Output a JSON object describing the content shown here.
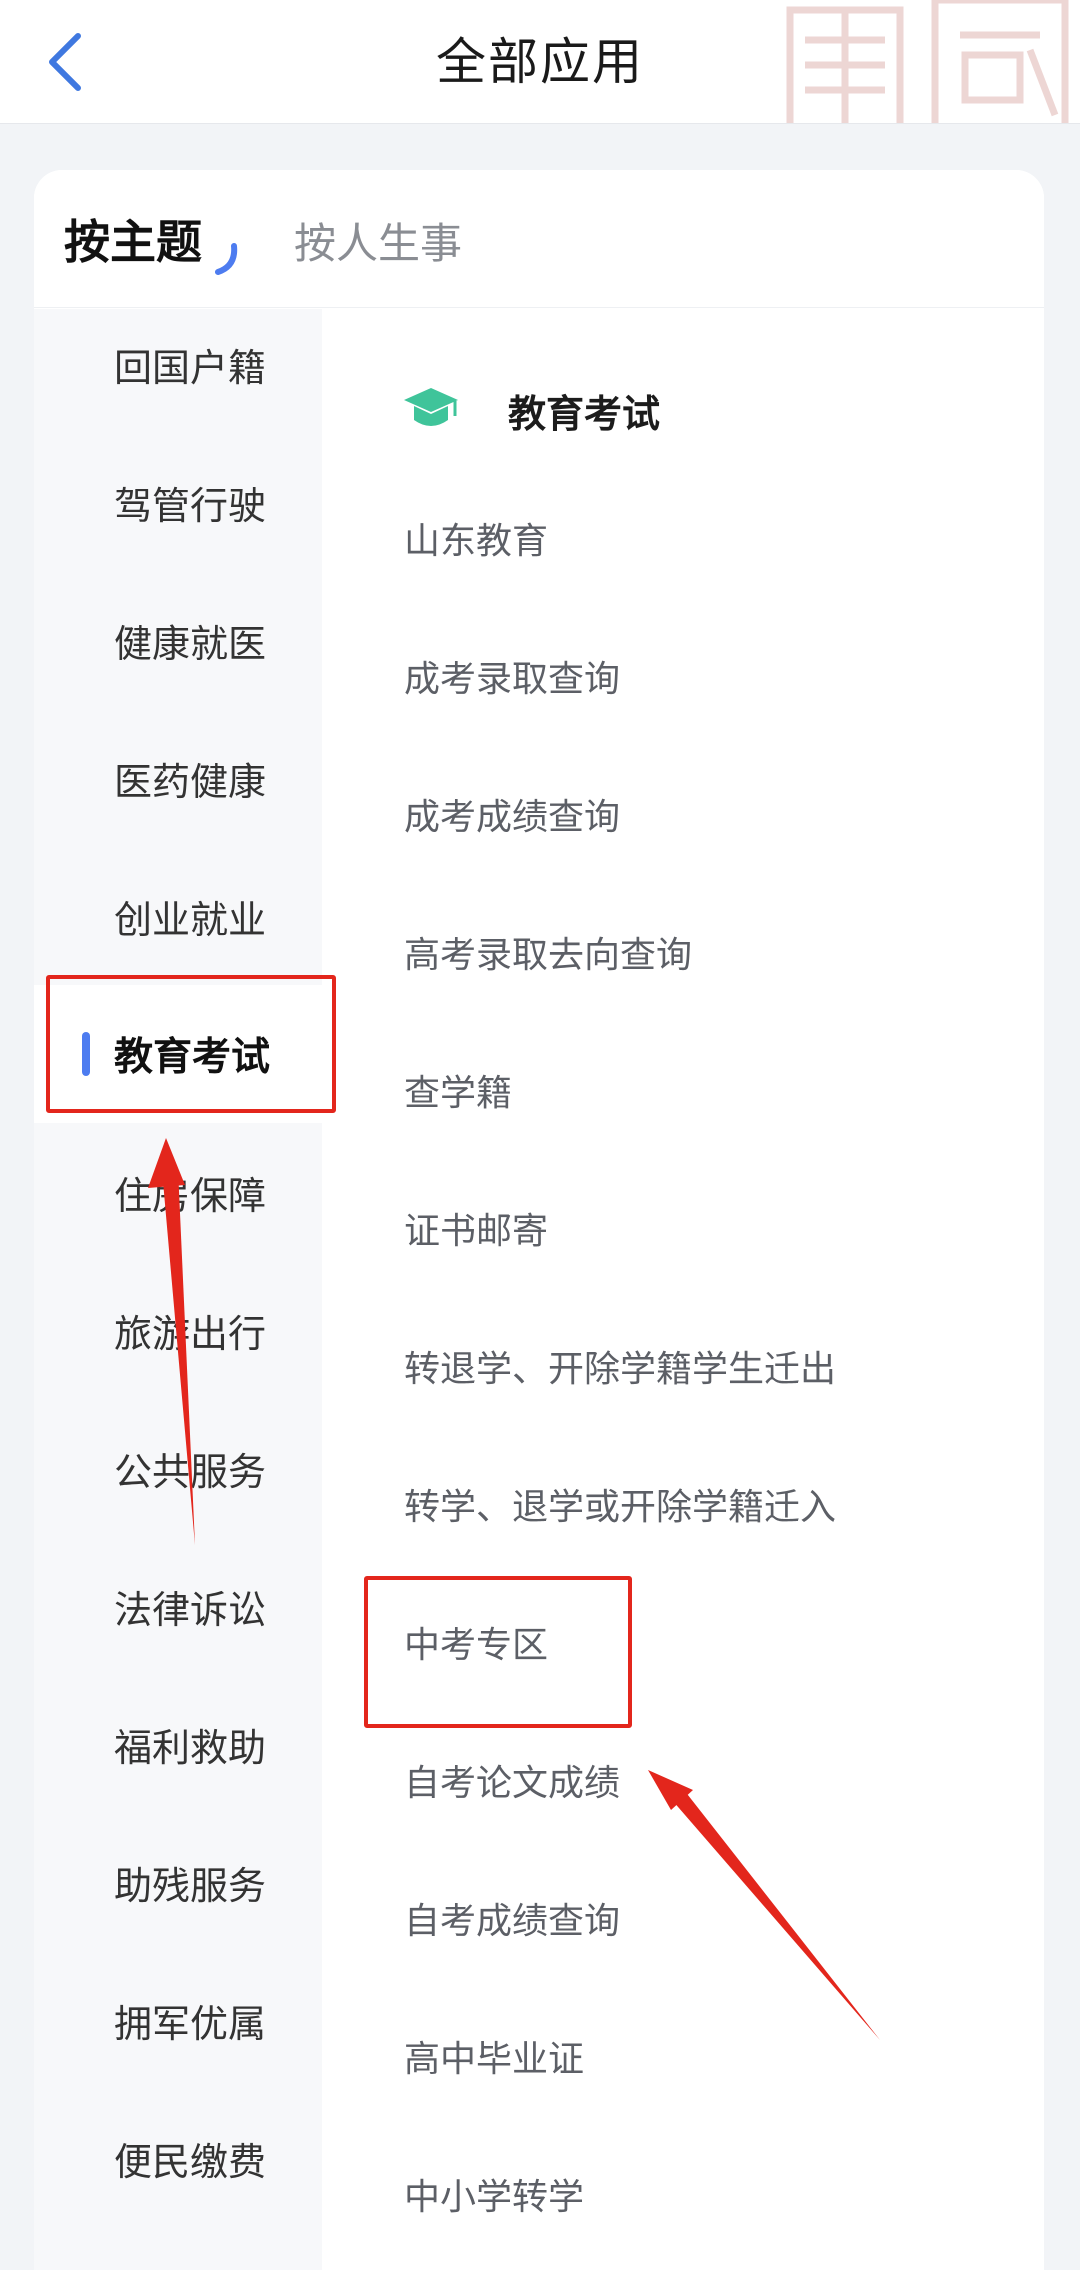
{
  "header": {
    "title": "全部应用",
    "back_icon": "chevron-left-icon",
    "seal_icon": "seal-watermark"
  },
  "tabs": {
    "active": "按主题",
    "inactive": "按人生事"
  },
  "sidebar": {
    "items": [
      {
        "label": "回国户籍"
      },
      {
        "label": "驾管行驶"
      },
      {
        "label": "健康就医"
      },
      {
        "label": "医药健康"
      },
      {
        "label": "创业就业"
      },
      {
        "label": "教育考试",
        "active": true
      },
      {
        "label": "住房保障"
      },
      {
        "label": "旅游出行"
      },
      {
        "label": "公共服务"
      },
      {
        "label": "法律诉讼"
      },
      {
        "label": "福利救助"
      },
      {
        "label": "助残服务"
      },
      {
        "label": "拥军优属"
      },
      {
        "label": "便民缴费"
      }
    ]
  },
  "section": {
    "icon": "graduation-cap-icon",
    "title": "教育考试",
    "items": [
      {
        "label": "山东教育"
      },
      {
        "label": "成考录取查询"
      },
      {
        "label": "成考成绩查询"
      },
      {
        "label": "高考录取去向查询"
      },
      {
        "label": "查学籍"
      },
      {
        "label": "证书邮寄"
      },
      {
        "label": "转退学、开除学籍学生迁出"
      },
      {
        "label": "转学、退学或开除学籍迁入"
      },
      {
        "label": "中考专区"
      },
      {
        "label": "自考论文成绩"
      },
      {
        "label": "自考成绩查询"
      },
      {
        "label": "高中毕业证"
      },
      {
        "label": "中小学转学"
      }
    ]
  },
  "colors": {
    "accent": "#4d7cf0",
    "icon_green": "#3fc49a",
    "annotation_red": "#e3261c"
  }
}
